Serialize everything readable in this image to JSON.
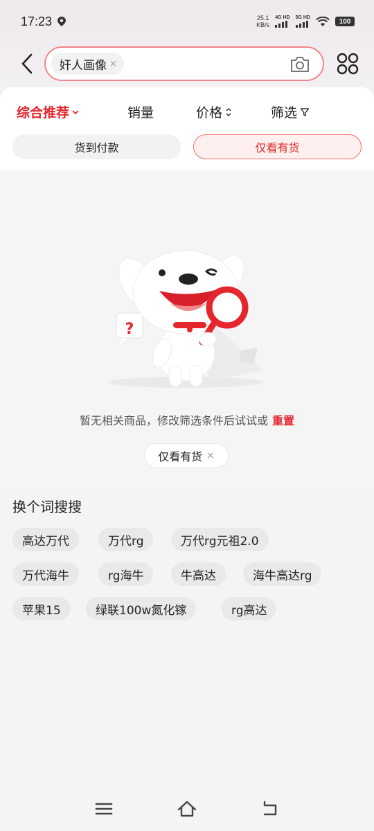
{
  "status_bar": {
    "time": "17:23",
    "net_speed_value": "25.1",
    "net_speed_unit": "KB/s",
    "sim1_label": "4G HD",
    "sim2_label": "5G HD",
    "battery": "100"
  },
  "search": {
    "query_chip": "奸人画像",
    "chip_clear": "×"
  },
  "sort_tabs": [
    {
      "label": "综合推荐"
    },
    {
      "label": "销量"
    },
    {
      "label": "价格"
    },
    {
      "label": "筛选"
    }
  ],
  "filters": {
    "cod": "货到付款",
    "in_stock": "仅看有货"
  },
  "empty_state": {
    "message": "暂无相关商品，修改筛选条件后试试或",
    "reset": "重置",
    "active_filter": "仅看有货",
    "active_filter_clear": "×"
  },
  "suggestions": {
    "title": "换个词搜搜",
    "tags": [
      "高达万代",
      "万代rg",
      "万代rg元祖2.0",
      "万代海牛",
      "rg海牛",
      "牛高达",
      "海牛高达rg",
      "苹果15",
      "绿联100w氮化镓",
      "rg高达"
    ]
  },
  "colors": {
    "accent": "#e5262d",
    "search_border": "#f0868a"
  }
}
